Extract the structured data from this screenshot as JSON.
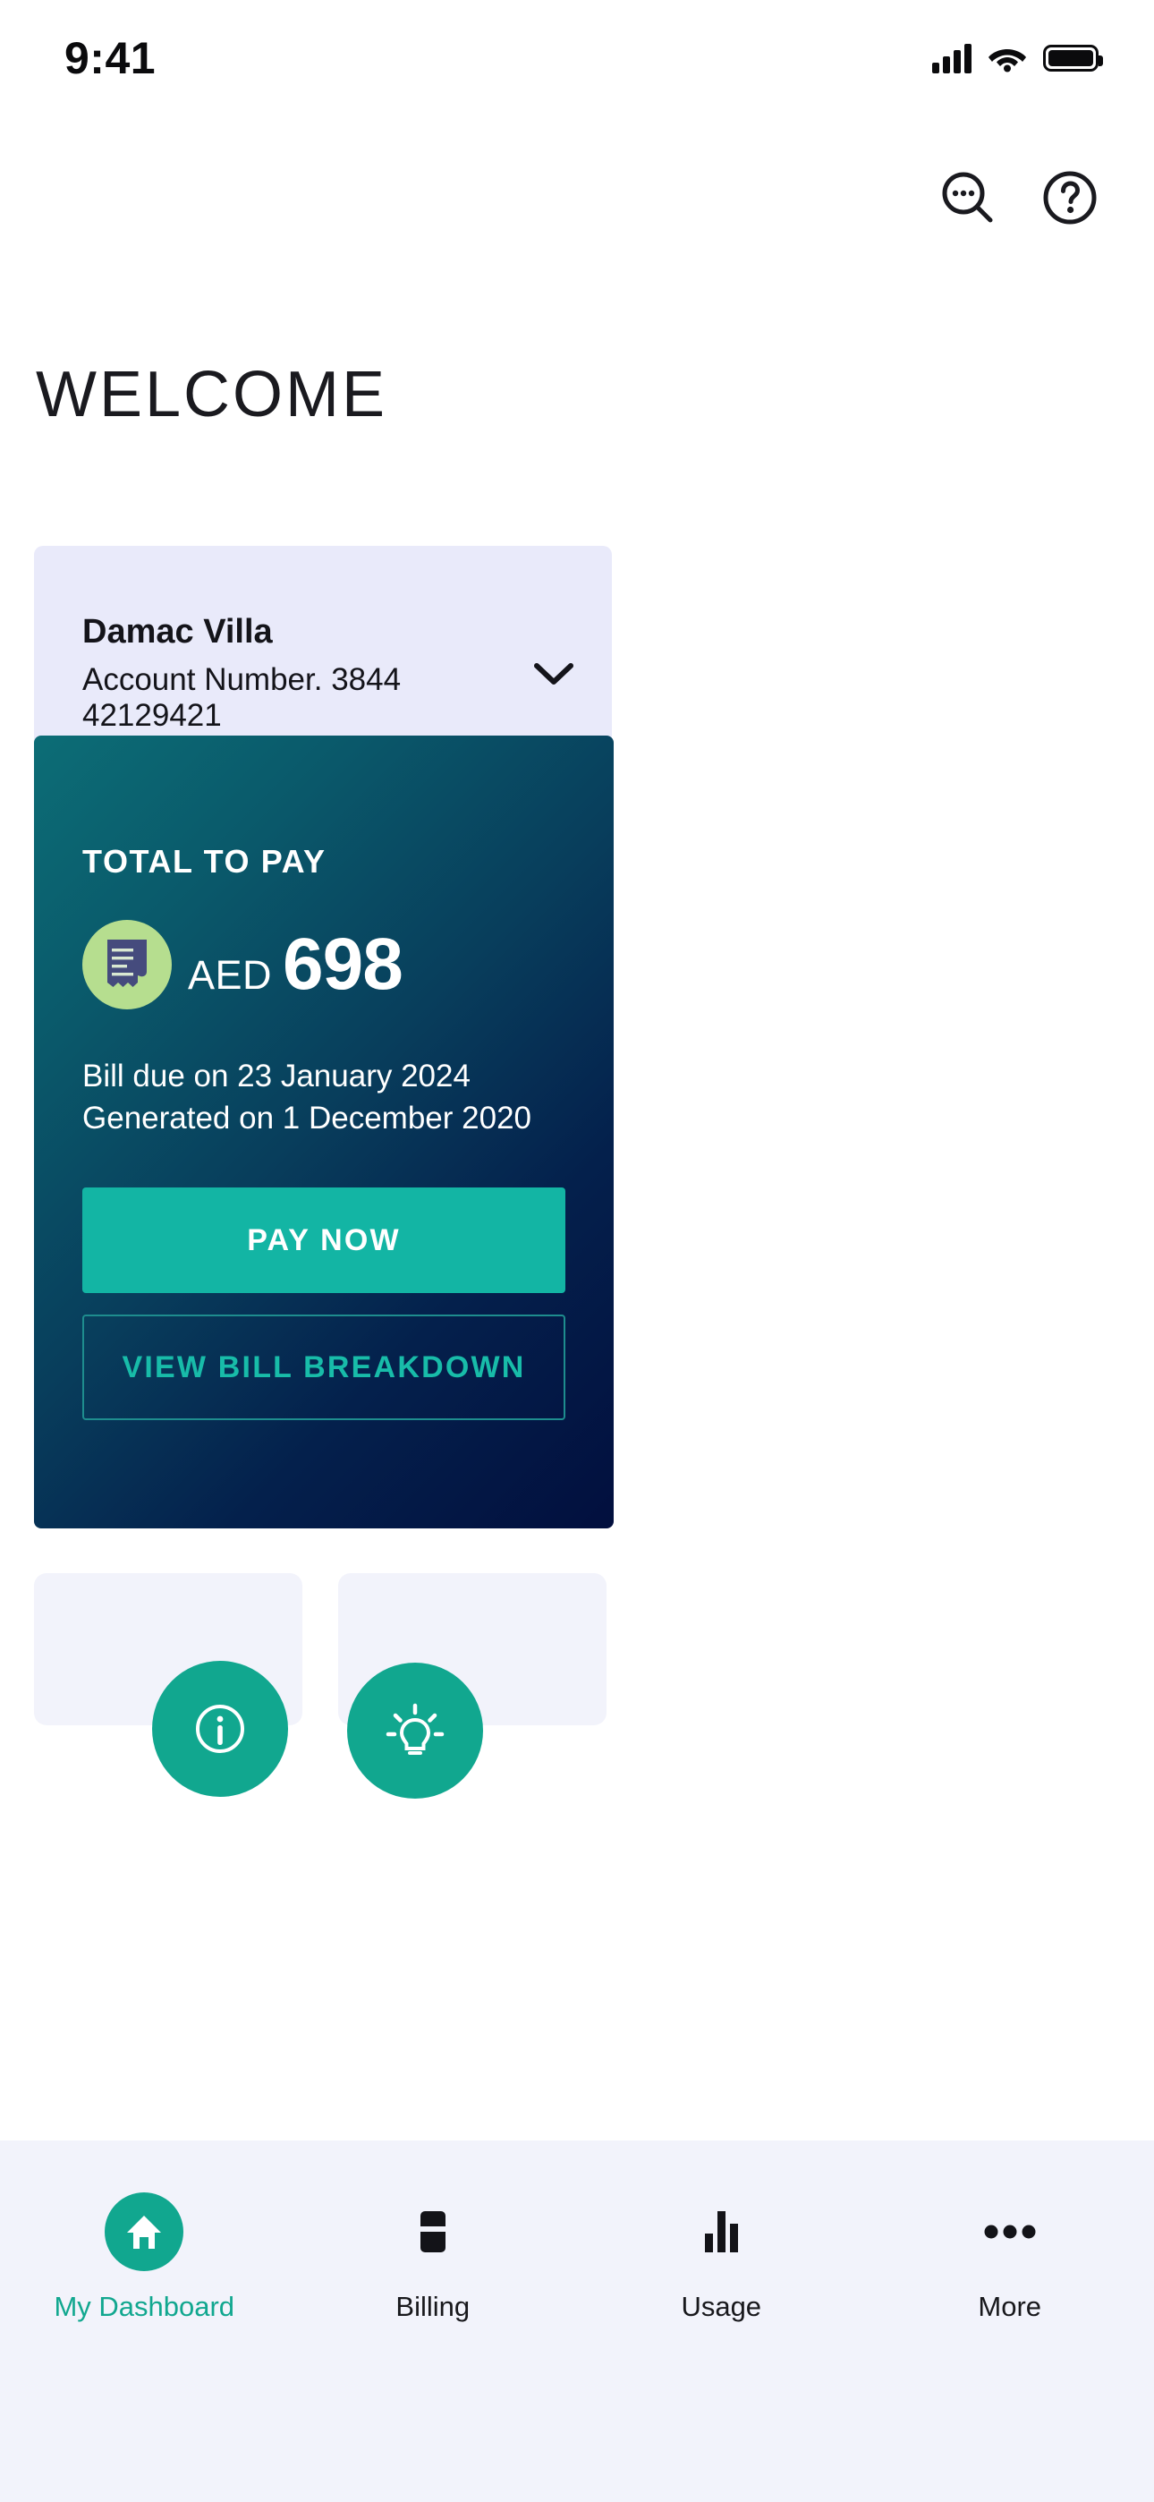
{
  "statusbar": {
    "time": "9:41",
    "signal_icon": "cellular-signal-icon",
    "wifi_icon": "wifi-icon",
    "battery_icon": "battery-full-icon"
  },
  "header": {
    "search_icon": "search-icon",
    "help_icon": "help-circle-icon",
    "title": "WELCOME"
  },
  "account": {
    "name": "Damac Villa",
    "number_label": "Account Number. 3844 42129421",
    "expand_icon": "chevron-down-icon"
  },
  "bill": {
    "label": "TOTAL TO PAY",
    "receipt_icon": "receipt-icon",
    "currency": "AED",
    "amount": "698",
    "due_line": "Bill due on 23 January 2024",
    "generated_line": "Generated on 1 December 2020",
    "pay_button": "PAY NOW",
    "breakdown_button": "VIEW BILL BREAKDOWN"
  },
  "peek_cards": [
    {
      "fab_icon": "info-icon"
    },
    {
      "fab_icon": "lightbulb-icon"
    }
  ],
  "bottom_nav": {
    "items": [
      {
        "label": "My Dashboard",
        "icon": "home-icon",
        "active": true
      },
      {
        "label": "Billing",
        "icon": "credit-card-icon",
        "active": false
      },
      {
        "label": "Usage",
        "icon": "bar-chart-icon",
        "active": false
      },
      {
        "label": "More",
        "icon": "ellipsis-icon",
        "active": false
      }
    ]
  },
  "colors": {
    "accent_teal": "#11A78F",
    "button_teal": "#13B5A4",
    "outline_teal": "#18BCA9",
    "card_lavender": "#E9EAFA",
    "nav_bg": "#F2F3FB",
    "badge_green": "#B6DE8F",
    "receipt_navy": "#454B7D",
    "gradient_from": "#0C6D76",
    "gradient_to": "#020F3E",
    "text_dark": "#14141A"
  }
}
